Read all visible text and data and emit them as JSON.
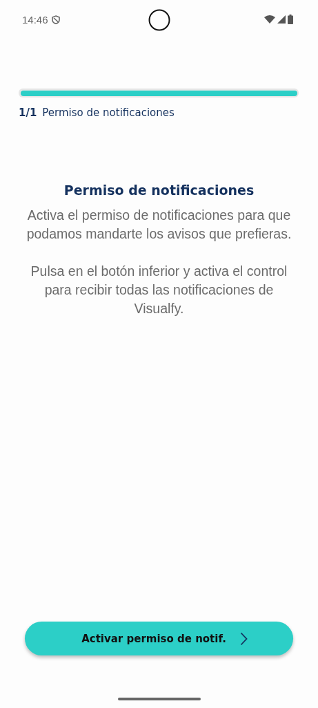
{
  "status_bar": {
    "time": "14:46"
  },
  "progress": {
    "level": 1.0,
    "step": "1/1",
    "step_title": "Permiso de notificaciones"
  },
  "title": "Permiso de notificaciones",
  "paragraphs": [
    "Activa el permiso de notificaciones para que podamos mandarte los avisos que prefieras.",
    "Pulsa en el botón inferior y activa el control para recibir todas las notificaciones de Visualfy."
  ],
  "button": {
    "label": "Activar permiso de notif."
  }
}
